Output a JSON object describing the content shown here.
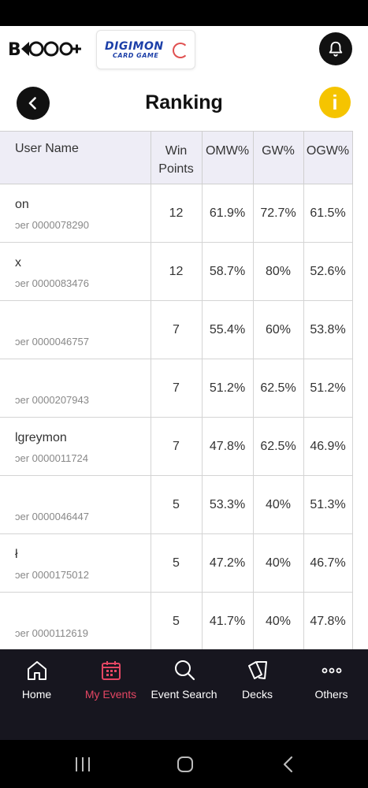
{
  "header": {
    "brand_logo_text": "B•••+",
    "digimon_logo": {
      "top": "DIGIMON",
      "bottom": "CARD GAME"
    }
  },
  "title_bar": {
    "title": "Ranking",
    "info_glyph": "i"
  },
  "table": {
    "columns": [
      "User Name",
      "Win\nPoints",
      "OMW%",
      "GW%",
      "OGW%"
    ],
    "rows": [
      {
        "name": "on",
        "id": "ɔer 0000078290",
        "win_points": "12",
        "omw": "61.9%",
        "gw": "72.7%",
        "ogw": "61.5%"
      },
      {
        "name": "x",
        "id": "ɔer 0000083476",
        "win_points": "12",
        "omw": "58.7%",
        "gw": "80%",
        "ogw": "52.6%"
      },
      {
        "name": "",
        "id": "ɔer 0000046757",
        "win_points": "7",
        "omw": "55.4%",
        "gw": "60%",
        "ogw": "53.8%"
      },
      {
        "name": "",
        "id": "ɔer 0000207943",
        "win_points": "7",
        "omw": "51.2%",
        "gw": "62.5%",
        "ogw": "51.2%"
      },
      {
        "name": "lgreymon",
        "id": "ɔer 0000011724",
        "win_points": "7",
        "omw": "47.8%",
        "gw": "62.5%",
        "ogw": "46.9%"
      },
      {
        "name": "",
        "id": "ɔer 0000046447",
        "win_points": "5",
        "omw": "53.3%",
        "gw": "40%",
        "ogw": "51.3%"
      },
      {
        "name": "ł",
        "id": "ɔer 0000175012",
        "win_points": "5",
        "omw": "47.2%",
        "gw": "40%",
        "ogw": "46.7%"
      },
      {
        "name": "",
        "id": "ɔer 0000112619",
        "win_points": "5",
        "omw": "41.7%",
        "gw": "40%",
        "ogw": "47.8%"
      }
    ]
  },
  "bottom_nav": {
    "items": [
      {
        "label": "Home",
        "icon": "home-icon"
      },
      {
        "label": "My Events",
        "icon": "calendar-icon",
        "active": true
      },
      {
        "label": "Event Search",
        "icon": "search-icon"
      },
      {
        "label": "Decks",
        "icon": "cards-icon"
      },
      {
        "label": "Others",
        "icon": "more-icon"
      }
    ]
  },
  "colors": {
    "active_nav": "#e44663",
    "nav_background": "#17161f",
    "info_button": "#f5c400",
    "table_header": "#eeedf6"
  }
}
